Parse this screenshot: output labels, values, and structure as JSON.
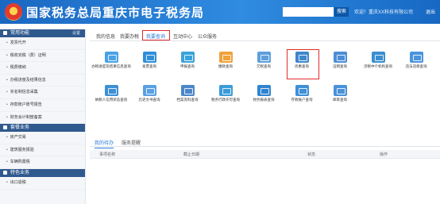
{
  "header": {
    "title": "国家税务总局重庆市电子税务局",
    "search_placeholder": "",
    "search_button": "搜索",
    "user_info": "欢迎！重庆XX科技有限公司",
    "logout": "退出"
  },
  "sidebar": {
    "sections": [
      {
        "title": "常用功能",
        "action": "设置",
        "items": [
          "发票代开",
          "税收完税（费）证明",
          "税费缴纳",
          "办税进度及结果信息",
          "实名制信息采集",
          "存款账户账号报告",
          "财务会计制度备案"
        ]
      },
      {
        "title": "套餐业务",
        "items": [
          "房产交易",
          "建筑服务报验",
          "车辆购置税"
        ]
      },
      {
        "title": "特色业务",
        "items": [
          "出口退税"
        ]
      }
    ]
  },
  "main": {
    "tabs": [
      "我的信息",
      "我要办税",
      "我要查询",
      "互动中心",
      "公众服务"
    ],
    "active_tab": 2,
    "functions": [
      "办税进度及结果信息查询",
      "发票查询",
      "申报查询",
      "缴款查询",
      "欠税查询",
      "优惠查询",
      "证明查询",
      "涉税中介机构查询",
      "违法违章查询",
      "纳税人信用状态查询",
      "历史文书查询",
      "档案资料查询",
      "税务行政许可查询",
      "财务报表查询",
      "存款账户查询",
      "邮寄查询"
    ],
    "highlighted_function": 5,
    "subtabs": [
      "我的待办",
      "服务提醒"
    ],
    "active_subtab": 0,
    "table_headers": [
      "事项名称",
      "截止日期",
      "状态",
      "操作"
    ]
  },
  "colors": {
    "header_bg": "#1a67c2",
    "accent": "#2a78d6",
    "highlight_border": "#e22c2c",
    "icon_colors": [
      "#4aa2e6",
      "#2f8fd8",
      "#3aa3d9",
      "#f0a23a",
      "#5e9fdc",
      "#3f86cc",
      "#4b8ed6",
      "#3a8fd0",
      "#4a94dc",
      "#3e90d4",
      "#5aa0e2",
      "#4b87c8",
      "#3b9bd6",
      "#2f84cf",
      "#3f8fd6",
      "#4a92d8"
    ]
  }
}
